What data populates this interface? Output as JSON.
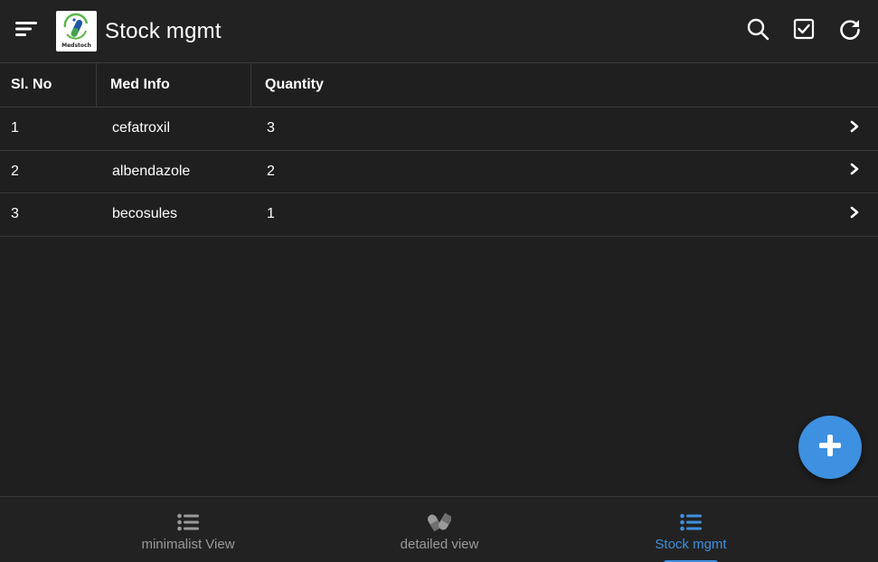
{
  "header": {
    "title": "Stock mgmt",
    "logo_text": "Medstoch",
    "icons": [
      "menu-icon",
      "search-icon",
      "checkbox-icon",
      "refresh-icon"
    ]
  },
  "table": {
    "columns": [
      "Sl. No",
      "Med Info",
      "Quantity"
    ],
    "rows": [
      {
        "sl": "1",
        "med": "cefatroxil",
        "qty": "3"
      },
      {
        "sl": "2",
        "med": "albendazole",
        "qty": "2"
      },
      {
        "sl": "3",
        "med": "becosules",
        "qty": "1"
      }
    ]
  },
  "fab": {
    "icon": "plus-icon"
  },
  "bottom_nav": {
    "tabs": [
      {
        "label": "minimalist View",
        "icon": "list-icon",
        "active": false
      },
      {
        "label": "detailed view",
        "icon": "pills-icon",
        "active": false
      },
      {
        "label": "Stock mgmt",
        "icon": "list-icon",
        "active": true
      }
    ]
  },
  "colors": {
    "background": "#1f1f1f",
    "bar": "#222222",
    "accent": "#3e90e0",
    "inactive": "#9a9a9a",
    "divider": "#3a3a3a"
  }
}
